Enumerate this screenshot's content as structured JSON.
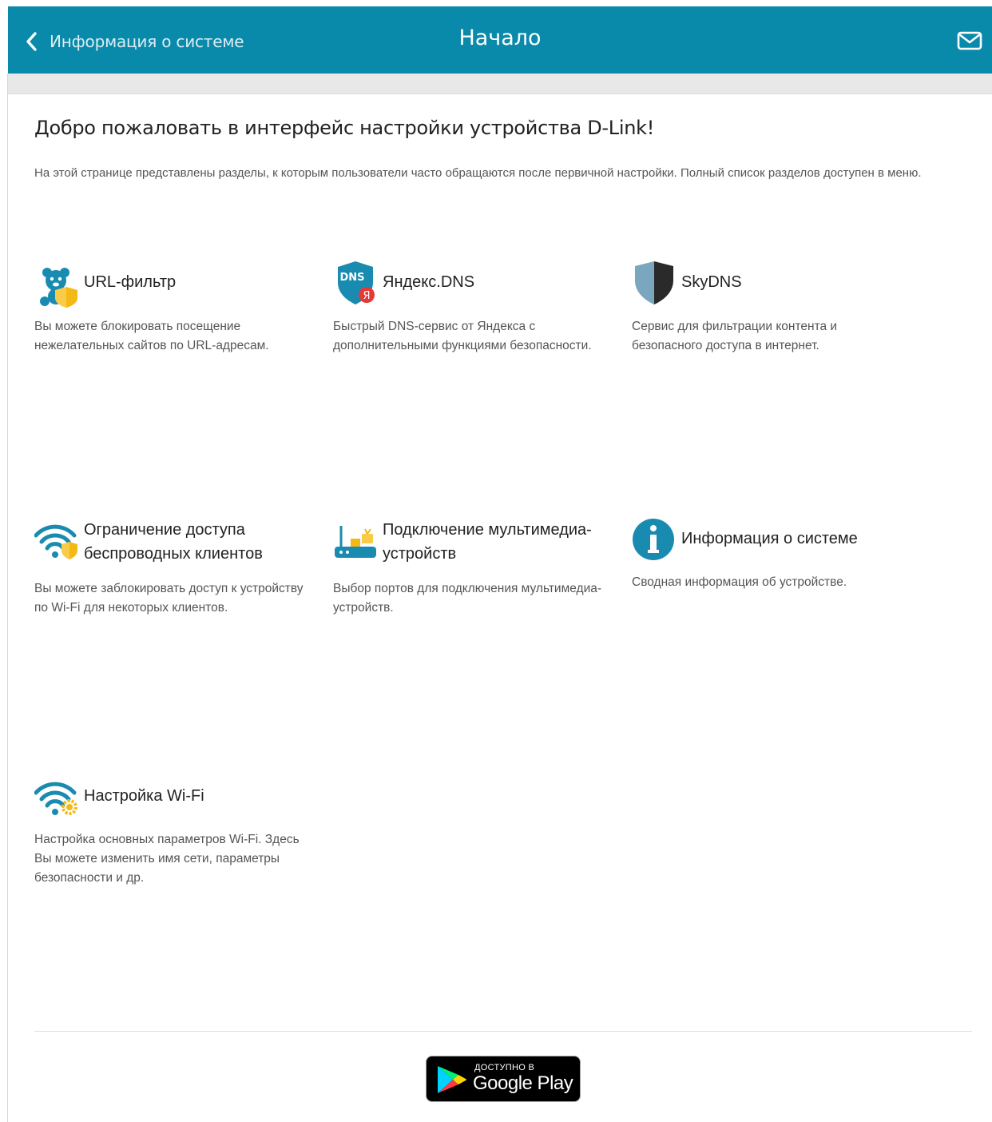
{
  "header": {
    "back_label": "Информация о системе",
    "title": "Начало"
  },
  "welcome": {
    "heading": "Добро пожаловать в интерфейс настройки устройства D-Link!",
    "intro": "На этой странице представлены разделы, к которым пользователи часто обращаются после первичной настройки. Полный список разделов доступен в меню."
  },
  "cards": [
    {
      "title": "URL-фильтр",
      "desc": "Вы можете блокировать посещение нежелательных сайтов по URL-адресам.",
      "icon": "url-filter-icon"
    },
    {
      "title": "Яндекс.DNS",
      "desc": "Быстрый DNS-сервис от Яндекса с дополнительными функциями безопасности.",
      "icon": "yandex-dns-icon",
      "icon_text": "DNS",
      "badge": "Я"
    },
    {
      "title": "SkyDNS",
      "desc": "Сервис для фильтрации контента и безопасного доступа в интернет.",
      "icon": "skydns-shield-icon"
    },
    {
      "title": "Ограничение доступа беспроводных клиентов",
      "desc": "Вы можете заблокировать доступ к устройству по Wi-Fi для некоторых клиентов.",
      "icon": "wifi-shield-icon"
    },
    {
      "title": "Подключение мультимедиа-устройств",
      "desc": "Выбор портов для подключения мультимедиа-устройств.",
      "icon": "multimedia-icon"
    },
    {
      "title": "Информация о системе",
      "desc": "Сводная информация об устройстве.",
      "icon": "info-icon"
    },
    {
      "title": "Настройка Wi-Fi",
      "desc": "Настройка основных параметров Wi-Fi. Здесь Вы можете изменить имя сети, параметры безопасности и др.",
      "icon": "wifi-gear-icon"
    }
  ],
  "google_play": {
    "small": "ДОСТУПНО В",
    "big": "Google Play"
  },
  "colors": {
    "header_bg": "#0a8aab",
    "icon_blue": "#1a8bb0",
    "shield_yellow": "#f5b915"
  }
}
